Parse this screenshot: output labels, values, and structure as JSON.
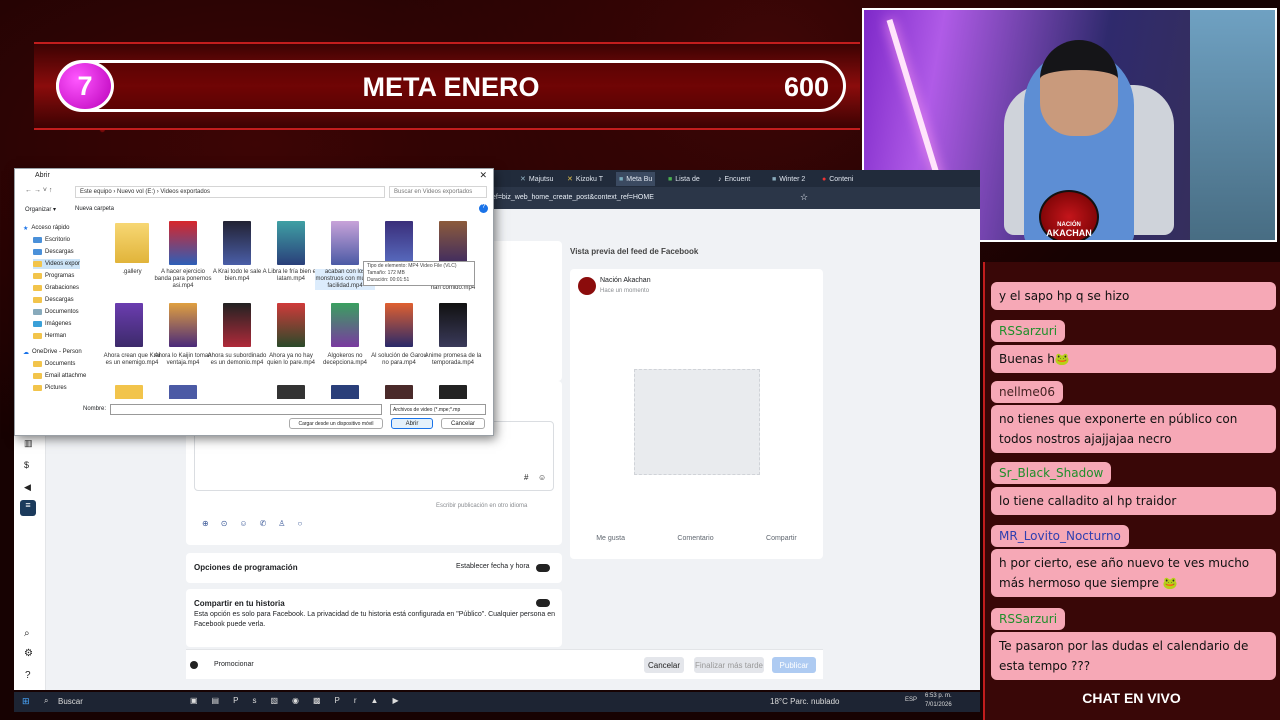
{
  "goal": {
    "number": "7",
    "title": "META ENERO",
    "target": "600"
  },
  "cam": {
    "logo_text": "NACIÓN",
    "logo_name": "AKACHAN"
  },
  "chat": {
    "footer": "CHAT EN VIVO",
    "messages": [
      {
        "text": "y el sapo hp q se hizo"
      },
      {
        "name": "RSSarzuri",
        "text": "Buenas h🐸"
      },
      {
        "name": "nellme06",
        "text": "no tienes que exponerte en público con todos nostros ajajjajaa necro"
      },
      {
        "name": "Sr_Black_Shadow",
        "text": "lo tiene calladito al hp traidor"
      },
      {
        "name": "MR_Lovito_Nocturno",
        "text": "h por cierto, ese año nuevo te ves mucho más hermoso que siempre 🐸"
      },
      {
        "name": "RSSarzuri",
        "text": "Te pasaron por las dudas el calendario de esta tempo ???"
      }
    ]
  },
  "browser": {
    "tabs": [
      "Majutsu",
      "Kizoku T",
      "Meta Bu",
      "Lista de",
      "Encuent",
      "Winter 2",
      "Conteni"
    ],
    "url": "ef=biz_web_home_create_post&context_ref=HOME"
  },
  "fb": {
    "preview_title": "Vista previa del feed de Facebook",
    "page_name": "Nación Akachan",
    "page_time": "Hace un momento",
    "actions": [
      "Me gusta",
      "Comentario",
      "Compartir"
    ],
    "translate_hint": "Escribir publicación en otro idioma",
    "schedule_title": "Opciones de programación",
    "schedule_toggle": "Establecer fecha y hora",
    "story_title": "Compartir en tu historia",
    "story_desc": "Esta opción es solo para Facebook. La privacidad de tu historia está configurada en \"Público\". Cualquier persona en Facebook puede verla.",
    "promote": "Promocionar",
    "cancel": "Cancelar",
    "later": "Finalizar más tarde",
    "publish": "Publicar"
  },
  "dialog": {
    "title": "Abrir",
    "path": [
      "Este equipo",
      "Nuevo vol (E:)",
      "Videos exportados"
    ],
    "search_placeholder": "Buscar en Videos exportados",
    "organize": "Organizar ▾",
    "new_folder": "Nueva carpeta",
    "nav": [
      "Acceso rápido",
      "Escritorio",
      "Descargas",
      "Videos expor",
      "Programas",
      "Grabaciones",
      "Descargas",
      "Documentos",
      "Imágenes",
      "Herman",
      "OneDrive - Person",
      "Documents",
      "Email attachme",
      "Pictures"
    ],
    "files": [
      ".gallery",
      "A hacer ejercicio banda para ponernos asi.mp4",
      "A Krai todo le sale bien.mp4",
      "A Libra le fría bien en latam.mp4",
      "acaban con los monstruos con mucha facilidad.mp4",
      "",
      "han comido.mp4",
      "Ahora crean que Krai es un enemigo.mp4",
      "Ahora lo Kaijin toman ventaja.mp4",
      "Ahora su subordinado es un demonio.mp4",
      "Ahora ya no hay quien lo pare.mp4",
      "Algokeros no decepciona.mp4",
      "Al solución de Garou no para.mp4",
      "Anime promesa de la temporada.mp4"
    ],
    "tooltip": [
      "Tipo de elemento: MP4 Video File (VLC)",
      "Tamaño: 172 MB",
      "Duración: 00:01:51"
    ],
    "filename_label": "Nombre:",
    "filetype": "Archivos de video (*.mpe;*.mp",
    "mobile_btn": "Cargar desde un dispositivo móvil",
    "open_btn": "Abrir",
    "cancel_btn": "Cancelar"
  },
  "taskbar": {
    "search": "Buscar",
    "weather": "18°C  Parc. nublado",
    "lang": "ESP",
    "time": "6:53 p. m.",
    "date": "7/01/2026"
  }
}
